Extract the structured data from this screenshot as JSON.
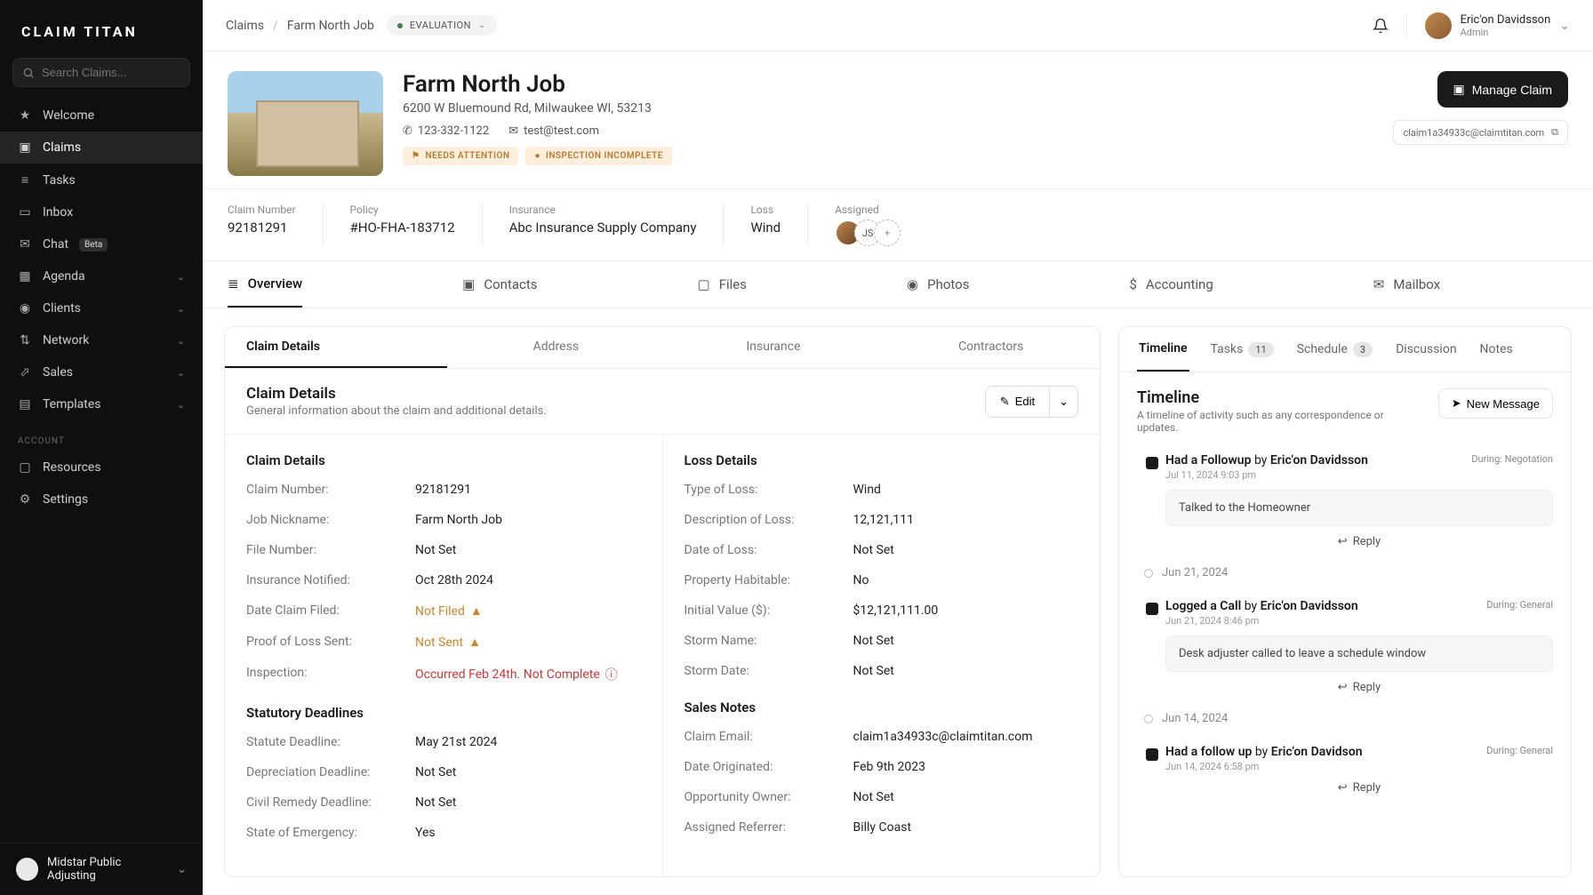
{
  "app": {
    "logo": "CLAIM TITAN"
  },
  "search": {
    "placeholder": "Search Claims..."
  },
  "nav": {
    "items": [
      {
        "label": "Welcome"
      },
      {
        "label": "Claims"
      },
      {
        "label": "Tasks"
      },
      {
        "label": "Inbox"
      },
      {
        "label": "Chat",
        "badge": "Beta"
      },
      {
        "label": "Agenda"
      },
      {
        "label": "Clients"
      },
      {
        "label": "Network"
      },
      {
        "label": "Sales"
      },
      {
        "label": "Templates"
      }
    ],
    "account_label": "ACCOUNT",
    "account_items": [
      {
        "label": "Resources"
      },
      {
        "label": "Settings"
      }
    ],
    "footer": "Midstar Public Adjusting"
  },
  "breadcrumbs": {
    "root": "Claims",
    "current": "Farm North Job"
  },
  "status": {
    "label": "EVALUATION"
  },
  "user": {
    "name": "Eric'on Davidsson",
    "role": "Admin"
  },
  "header": {
    "title": "Farm North Job",
    "address": "6200 W Bluemound Rd, Milwaukee WI, 53213",
    "phone": "123-332-1122",
    "email": "test@test.com",
    "flags": [
      "NEEDS ATTENTION",
      "INSPECTION INCOMPLETE"
    ],
    "manage_btn": "Manage Claim",
    "claim_email_chip": "claim1a34933c@claimtitan.com"
  },
  "meta": {
    "claim_number": {
      "label": "Claim Number",
      "value": "92181291"
    },
    "policy": {
      "label": "Policy",
      "value": "#HO-FHA-183712"
    },
    "insurance": {
      "label": "Insurance",
      "value": "Abc Insurance Supply Company"
    },
    "loss": {
      "label": "Loss",
      "value": "Wind"
    },
    "assigned": {
      "label": "Assigned",
      "initials": "JS"
    }
  },
  "ptabs": [
    "Overview",
    "Contacts",
    "Files",
    "Photos",
    "Accounting",
    "Mailbox"
  ],
  "subtabs": [
    "Claim Details",
    "Address",
    "Insurance",
    "Contractors"
  ],
  "section": {
    "title": "Claim Details",
    "desc": "General information about the claim and additional details.",
    "edit": "Edit"
  },
  "details": {
    "left_title": "Claim Details",
    "right_title": "Loss Details",
    "stat_title": "Statutory Deadlines",
    "sales_title": "Sales Notes",
    "left": [
      {
        "k": "Claim Number:",
        "v": "92181291"
      },
      {
        "k": "Job Nickname:",
        "v": "Farm North Job"
      },
      {
        "k": "File Number:",
        "v": "Not Set"
      },
      {
        "k": "Insurance Notified:",
        "v": "Oct 28th 2024"
      },
      {
        "k": "Date Claim Filed:",
        "v": "Not Filed",
        "warn": true
      },
      {
        "k": "Proof of Loss Sent:",
        "v": "Not Sent",
        "warn": true
      },
      {
        "k": "Inspection:",
        "v": "Occurred Feb 24th. Not Complete",
        "err": true
      }
    ],
    "right": [
      {
        "k": "Type of Loss:",
        "v": "Wind"
      },
      {
        "k": "Description of Loss:",
        "v": "12,121,111"
      },
      {
        "k": "Date of Loss:",
        "v": "Not Set"
      },
      {
        "k": "Property Habitable:",
        "v": "No"
      },
      {
        "k": "Initial Value ($):",
        "v": "$12,121,111.00"
      },
      {
        "k": "Storm Name:",
        "v": "Not Set"
      },
      {
        "k": "Storm Date:",
        "v": "Not Set"
      }
    ],
    "stat": [
      {
        "k": "Statute Deadline:",
        "v": "May 21st 2024"
      },
      {
        "k": "Depreciation Deadline:",
        "v": "Not Set"
      },
      {
        "k": "Civil Remedy Deadline:",
        "v": "Not Set"
      },
      {
        "k": "State of Emergency:",
        "v": "Yes"
      }
    ],
    "sales": [
      {
        "k": "Claim Email:",
        "v": "claim1a34933c@claimtitan.com"
      },
      {
        "k": "Date Originated:",
        "v": "Feb 9th 2023"
      },
      {
        "k": "Opportunity Owner:",
        "v": "Not Set"
      },
      {
        "k": "Assigned Referrer:",
        "v": "Billy Coast"
      }
    ]
  },
  "rtabs": {
    "timeline": "Timeline",
    "tasks": "Tasks",
    "tasks_count": "11",
    "schedule": "Schedule",
    "schedule_count": "3",
    "discussion": "Discussion",
    "notes": "Notes"
  },
  "timeline": {
    "title": "Timeline",
    "desc": "A timeline of activity such as any correspondence or updates.",
    "new_btn": "New Message",
    "items": [
      {
        "title_a": "Had a Followup",
        "by": "by",
        "author": "Eric'on Davidsson",
        "sub": "Jul 11, 2024 9:03 pm",
        "during": "During: Negotation",
        "note": "Talked to the Homeowner",
        "reply": "Reply"
      },
      {
        "date": "Jun 21, 2024"
      },
      {
        "title_a": "Logged a Call",
        "by": "by",
        "author": "Eric'on Davidsson",
        "sub": "Jun 21, 2024 8:46 pm",
        "during": "During: General",
        "note": "Desk adjuster called to leave a schedule window",
        "reply": "Reply"
      },
      {
        "date": "Jun 14, 2024"
      },
      {
        "title_a": "Had a follow up",
        "by": "by",
        "author": "Eric'on Davidson",
        "sub": "Jun 14, 2024 6:58 pm",
        "during": "During: General",
        "reply": "Reply"
      }
    ]
  }
}
